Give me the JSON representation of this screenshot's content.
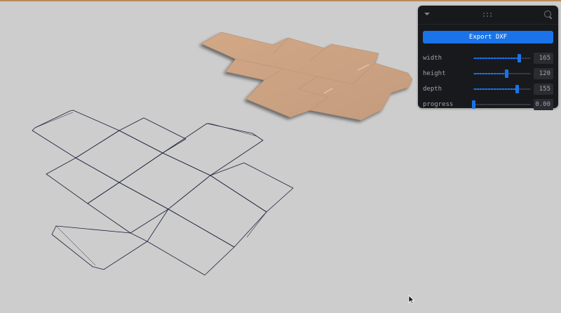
{
  "app": {
    "background_color": "#cdcdcd",
    "box_color": "#c9a183",
    "line_color": "#1c1f3a"
  },
  "panel": {
    "collapse_icon": "chevron-down-icon",
    "drag_icon": "drag-handle-icon",
    "search_icon": "search-icon",
    "export_label": "Export DXF",
    "accent_color": "#1a73e8",
    "params": [
      {
        "id": "width",
        "label": "width",
        "value": "165",
        "fraction": 0.79
      },
      {
        "id": "height",
        "label": "height",
        "value": "120",
        "fraction": 0.57
      },
      {
        "id": "depth",
        "label": "depth",
        "value": "155",
        "fraction": 0.75
      },
      {
        "id": "progress",
        "label": "progress",
        "value": "0.00",
        "fraction": 0.0
      }
    ]
  }
}
